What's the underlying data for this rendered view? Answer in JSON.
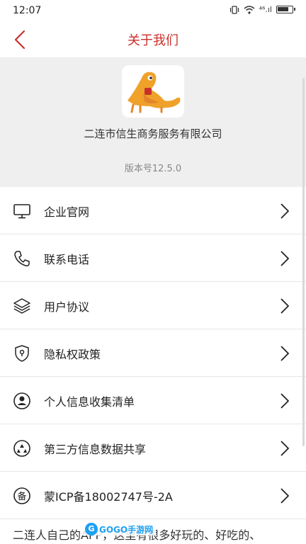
{
  "status_bar": {
    "time": "12:07",
    "network": "⁴⁶.ıl"
  },
  "nav": {
    "title": "关于我们",
    "back_icon": "chevron-left-icon"
  },
  "header": {
    "company_name": "二连市信生商务服务有限公司",
    "version": "版本号12.5.0"
  },
  "menu": [
    {
      "label": "企业官网",
      "icon": "monitor-icon"
    },
    {
      "label": "联系电话",
      "icon": "phone-icon"
    },
    {
      "label": "用户协议",
      "icon": "layers-icon"
    },
    {
      "label": "隐私权政策",
      "icon": "shield-icon"
    },
    {
      "label": "个人信息收集清单",
      "icon": "user-circle-icon"
    },
    {
      "label": "第三方信息数据共享",
      "icon": "recycle-icon"
    },
    {
      "label": "蒙ICP备18002747号-2A",
      "icon": "filing-icon"
    }
  ],
  "footer": {
    "text": "二连人自己的APP，这里有很多好玩的、好吃的、"
  },
  "watermark": {
    "badge": "G",
    "text": "GOGO手游网"
  },
  "colors": {
    "accent": "#c9302c",
    "header_bg": "#efefef"
  }
}
